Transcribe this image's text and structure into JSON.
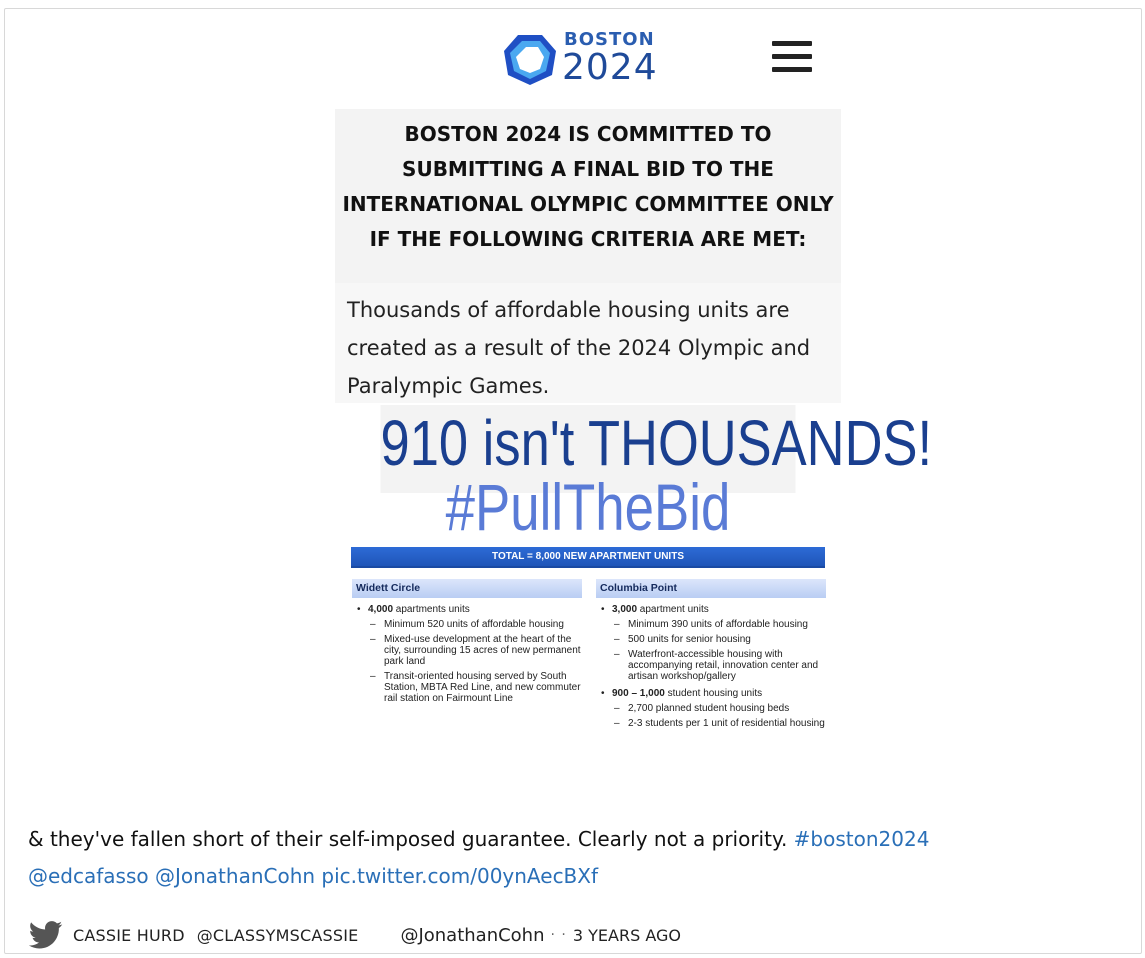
{
  "colors": {
    "link": "#2a6fb7",
    "logo_blue": "#1f4a99",
    "slogan_dark": "#1a3f8f",
    "slogan_light": "#5a7bd6",
    "table_header": "#1f55b8"
  },
  "image": {
    "logo": {
      "word": "BOSTON",
      "year": "2024"
    },
    "committed_text": "BOSTON 2024 IS COMMITTED TO SUBMITTING A FINAL BID TO THE INTERNATIONAL OLYMPIC COMMITTEE ONLY IF THE FOLLOWING CRITERIA ARE MET:",
    "criterion_text": "Thousands of affordable housing units are created as a result of the 2024 Olympic and Paralympic Games.",
    "slogan_line1": "910 isn't THOUSANDS!",
    "slogan_line2": "#PullTheBid",
    "plan": {
      "total": "TOTAL = 8,000 NEW APARTMENT UNITS",
      "left": {
        "title": "Widett Circle",
        "bullet_bold": "4,000",
        "bullet_rest": " apartments units",
        "subs": [
          "Minimum 520 units of affordable housing",
          "Mixed-use development at the heart of the city, surrounding 15 acres of new permanent park land",
          "Transit-oriented housing served by South Station, MBTA Red Line, and new commuter rail station on Fairmount Line"
        ]
      },
      "right": {
        "title": "Columbia Point",
        "bullet1_bold": "3,000",
        "bullet1_rest": " apartment units",
        "subs1": [
          "Minimum 390 units of affordable housing",
          "500 units for senior housing",
          "Waterfront-accessible housing with accompanying retail, innovation center and artisan workshop/gallery"
        ],
        "bullet2_bold": "900 – 1,000",
        "bullet2_rest": " student housing units",
        "subs2": [
          "2,700 planned student housing beds",
          "2-3 students per 1 unit of residential housing"
        ]
      }
    }
  },
  "tweet": {
    "text": "& they've fallen short of their self-imposed guarantee. Clearly not a priority. ",
    "hashtag": "#boston2024",
    "mention1": "@edcafasso",
    "mention2": "@JonathanCohn",
    "pic_link": "pic.twitter.com/00ynAecBXf"
  },
  "footer": {
    "author": "CASSIE HURD",
    "handle": "@CLASSYMSCASSIE",
    "reply_to": "@JonathanCohn",
    "dots": "· ·",
    "time_ago": "3 YEARS AGO"
  }
}
